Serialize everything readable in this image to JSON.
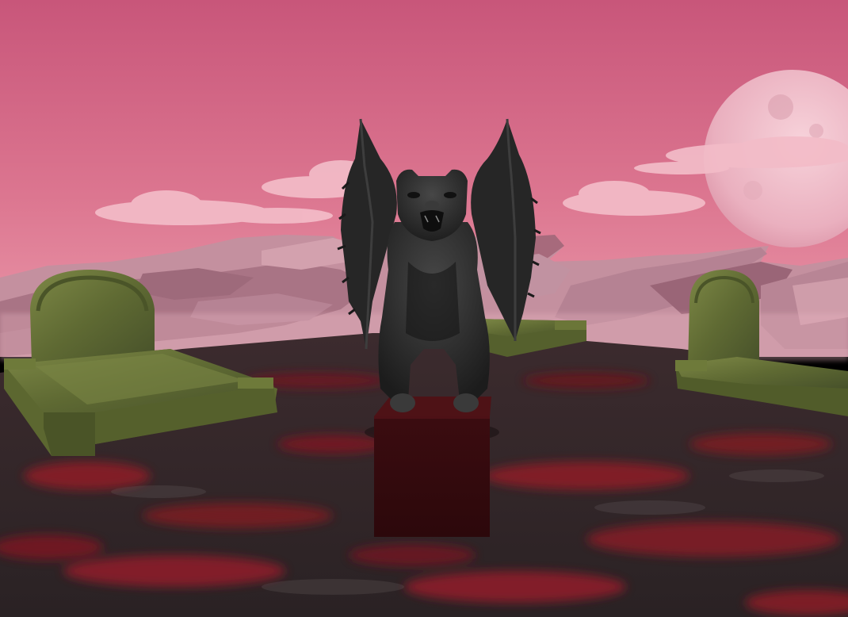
{
  "scene": {
    "description_visible_text": "",
    "colors": {
      "sky_top": "#c85a78",
      "sky_horizon": "#e88aa0",
      "cloud": "#f2b6c3",
      "moon": "#f0c0cc",
      "rock_far": "#b78797",
      "rock_near": "#8c5c6c",
      "ground_dark": "#3a2a2c",
      "ground_lava": "#8e1f28",
      "moss": "#6f7a3c",
      "moss_dark": "#3f4a22",
      "statue": "#2b2b2b",
      "statue_light": "#4a4a4a",
      "pedestal": "#3a0c0f",
      "pedestal_top": "#4e1216"
    },
    "objects": {
      "gargoyle": "winged-gargoyle-statue",
      "pedestal": "dark-red-pedestal",
      "tombstones": [
        "mossy-grave-left",
        "mossy-grave-center",
        "mossy-grave-right"
      ],
      "moon": "pink-moon",
      "terrain": "lava-rock-ground"
    }
  }
}
